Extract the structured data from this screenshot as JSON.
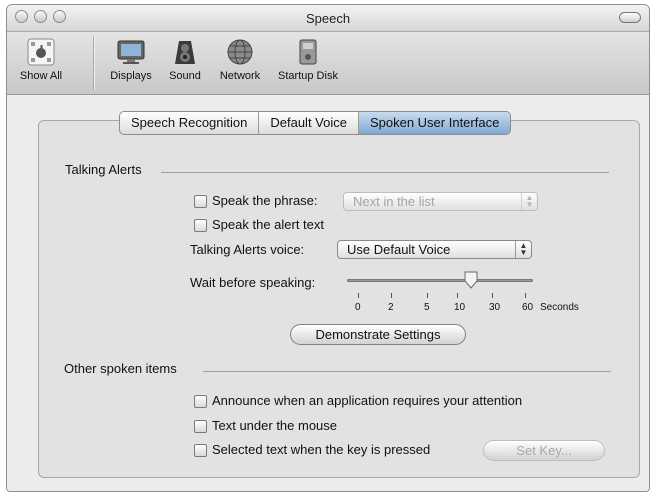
{
  "window": {
    "title": "Speech"
  },
  "toolbar": {
    "items": [
      {
        "label": "Show All",
        "icon": "apple-grid-icon"
      },
      {
        "label": "Displays",
        "icon": "display-icon"
      },
      {
        "label": "Sound",
        "icon": "speaker-icon"
      },
      {
        "label": "Network",
        "icon": "globe-icon"
      },
      {
        "label": "Startup Disk",
        "icon": "disk-icon"
      }
    ]
  },
  "tabs": [
    {
      "label": "Speech Recognition",
      "active": false
    },
    {
      "label": "Default Voice",
      "active": false
    },
    {
      "label": "Spoken User Interface",
      "active": true
    }
  ],
  "talking_alerts": {
    "heading": "Talking Alerts",
    "speak_phrase_label": "Speak the phrase:",
    "speak_phrase_value": "Next in the list",
    "speak_alert_text_label": "Speak the alert text",
    "voice_label": "Talking Alerts voice:",
    "voice_value": "Use Default Voice",
    "wait_label": "Wait before speaking:",
    "wait_ticks": [
      "0",
      "2",
      "5",
      "10",
      "30",
      "60"
    ],
    "wait_unit": "Seconds",
    "wait_value_seconds": 10,
    "demo_button": "Demonstrate Settings"
  },
  "other_items": {
    "heading": "Other spoken items",
    "announce_label": "Announce when an application requires your attention",
    "mouse_label": "Text under the mouse",
    "selected_label": "Selected text when the key is pressed",
    "set_key_button": "Set Key..."
  }
}
